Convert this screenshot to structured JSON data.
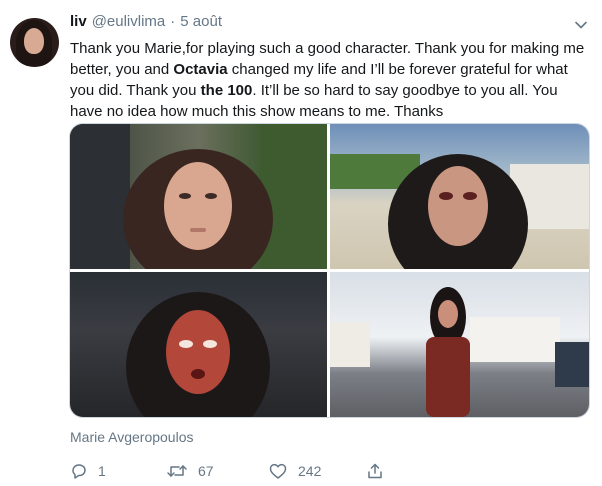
{
  "tweet": {
    "author_name": "liv",
    "handle": "@eulivlima",
    "separator": "·",
    "date": "5 août",
    "text_parts": [
      "Thank you Marie,for playing such a good character. Thank you for making me better, you and ",
      "Octavia",
      " changed my life and I’ll be forever grateful for what you did. Thank you ",
      "the 100",
      ". It’ll be so hard to say goodbye to you all. You have no idea how much this show means to me. Thanks"
    ],
    "media_caption": "Marie Avgeropoulos",
    "photos": [
      {
        "icon": "photo-1-icon"
      },
      {
        "icon": "photo-2-icon"
      },
      {
        "icon": "photo-3-icon"
      },
      {
        "icon": "photo-4-icon"
      }
    ]
  },
  "actions": {
    "reply_count": "1",
    "retweet_count": "67",
    "like_count": "242",
    "share_label": ""
  },
  "colors": {
    "text": "#14171a",
    "secondary": "#657786",
    "border": "#ccd6dd"
  }
}
